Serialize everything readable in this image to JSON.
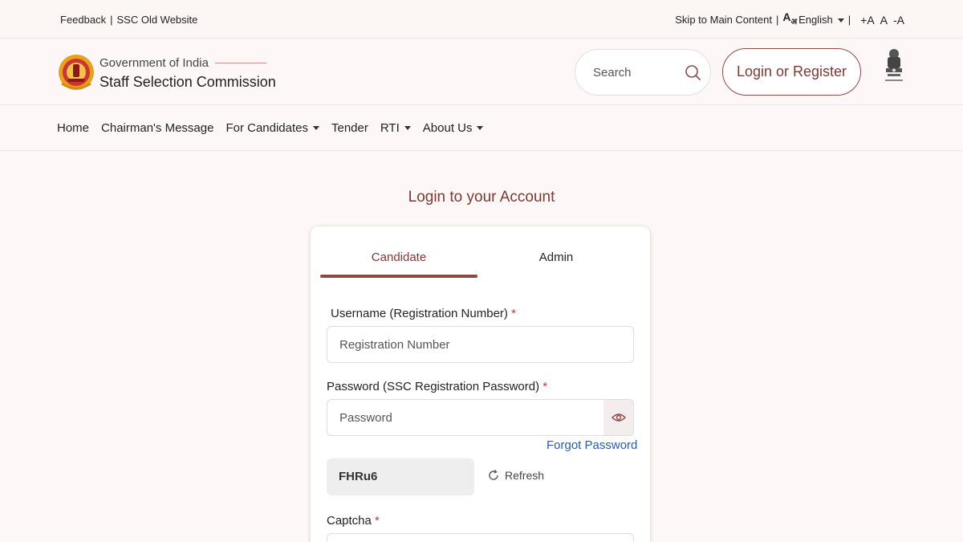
{
  "topbar": {
    "feedback": "Feedback",
    "old_website": "SSC Old Website",
    "skip_link": "Skip to Main Content",
    "language": "English",
    "font_increase": "+A",
    "font_normal": "A",
    "font_decrease": "-A"
  },
  "header": {
    "gov_label": "Government of India",
    "org_name": "Staff Selection Commission",
    "search_placeholder": "Search",
    "login_button": "Login or Register"
  },
  "nav": {
    "items": [
      {
        "label": "Home",
        "dropdown": false
      },
      {
        "label": "Chairman's Message",
        "dropdown": false
      },
      {
        "label": "For Candidates",
        "dropdown": true
      },
      {
        "label": "Tender",
        "dropdown": false
      },
      {
        "label": "RTI",
        "dropdown": true
      },
      {
        "label": "About Us",
        "dropdown": true
      }
    ]
  },
  "main": {
    "heading": "Login to your Account",
    "tabs": [
      {
        "label": "Candidate",
        "active": true
      },
      {
        "label": "Admin",
        "active": false
      }
    ],
    "username_label": "Username (Registration Number)",
    "username_placeholder": "Registration Number",
    "password_label": "Password (SSC Registration Password)",
    "password_placeholder": "Password",
    "required_mark": "*",
    "forgot_password": "Forgot Password",
    "captcha_text": "FHRu6",
    "refresh_label": "Refresh",
    "captcha_label": "Captcha"
  },
  "colors": {
    "accent": "#8b4a45",
    "link": "#2a5aa8",
    "background": "#fdf8f7"
  }
}
